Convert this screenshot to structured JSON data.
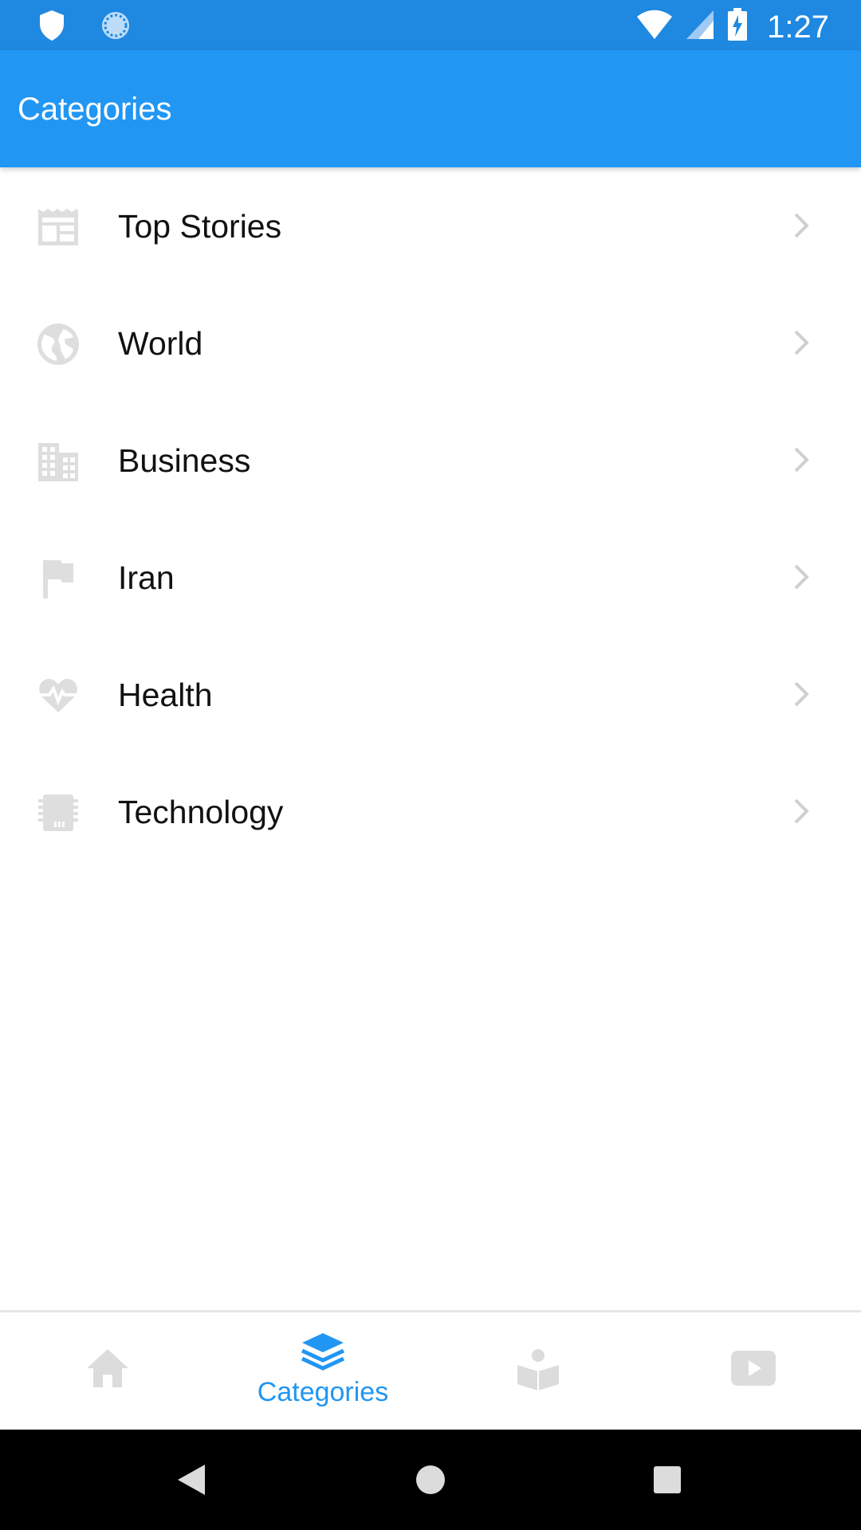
{
  "status_bar": {
    "time": "1:27",
    "left_icons": [
      "shield-icon",
      "sync-icon"
    ],
    "right_icons": [
      "wifi-icon",
      "signal-icon",
      "battery-charging-icon"
    ]
  },
  "app_bar": {
    "title": "Categories"
  },
  "categories": [
    {
      "label": "Top Stories",
      "icon": "newspaper-icon"
    },
    {
      "label": "World",
      "icon": "globe-icon"
    },
    {
      "label": "Business",
      "icon": "building-icon"
    },
    {
      "label": "Iran",
      "icon": "flag-icon"
    },
    {
      "label": "Health",
      "icon": "heart-pulse-icon"
    },
    {
      "label": "Technology",
      "icon": "chip-icon"
    }
  ],
  "bottom_nav": {
    "active_index": 1,
    "tabs": [
      {
        "icon": "home-icon",
        "label": ""
      },
      {
        "icon": "layers-icon",
        "label": "Categories"
      },
      {
        "icon": "reader-icon",
        "label": ""
      },
      {
        "icon": "video-play-icon",
        "label": ""
      }
    ]
  },
  "colors": {
    "status_bar": "#1f88e0",
    "app_bar": "#2196f3",
    "accent": "#2196f3",
    "inactive_icon": "#dcdcdc"
  }
}
